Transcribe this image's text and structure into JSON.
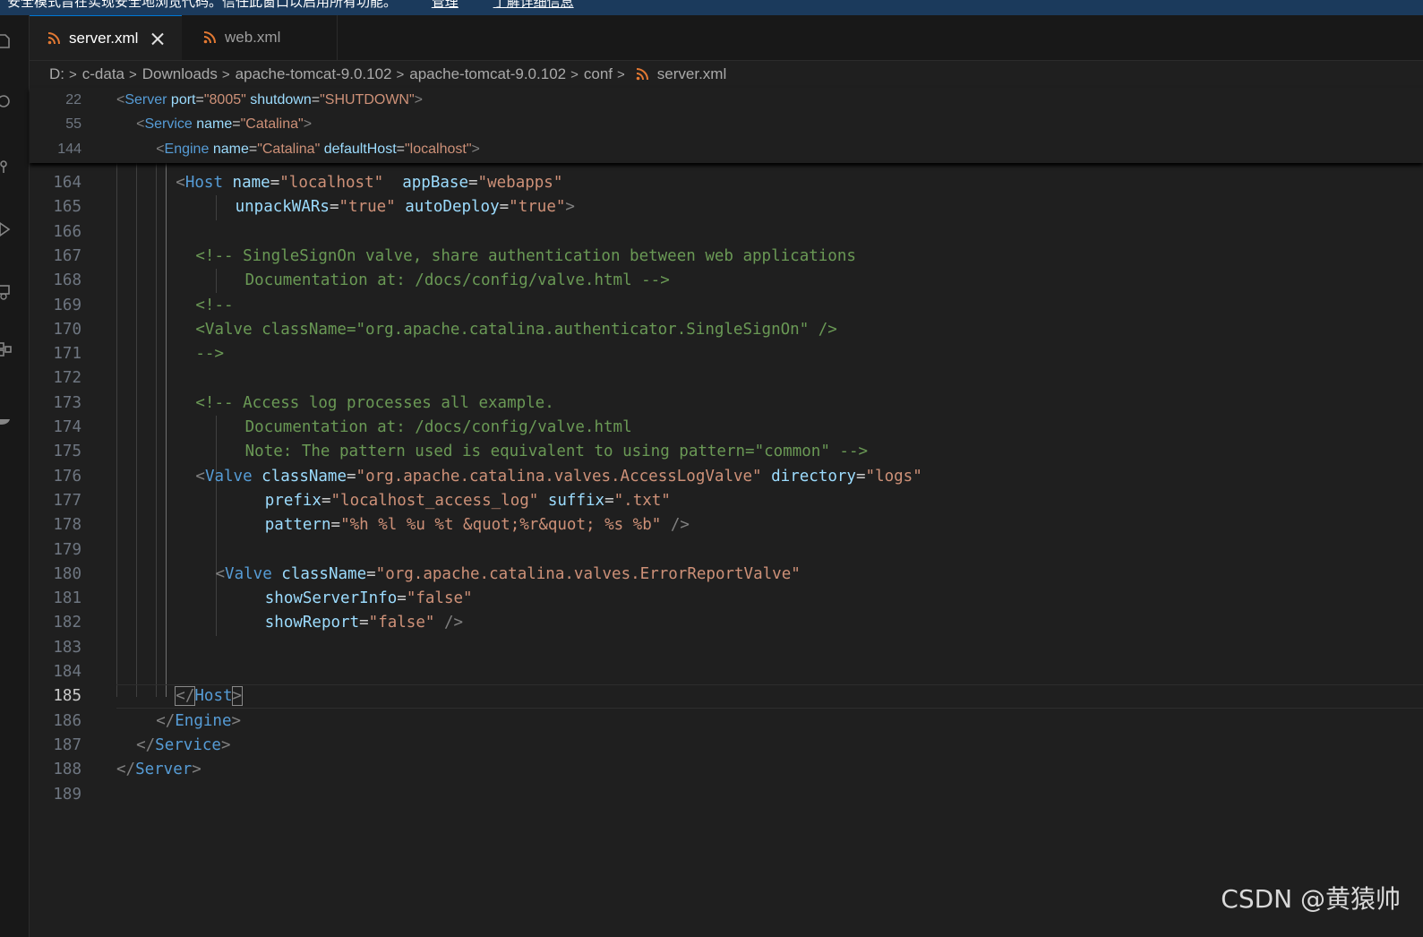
{
  "banner": {
    "text": "安全模式旨在实现安全地浏览代码。信任此窗口以启用所有功能。",
    "link_manage": "管理",
    "link_learn": "了解详细信息"
  },
  "tabs": [
    {
      "label": "server.xml",
      "icon": "rss-file-icon",
      "active": true
    },
    {
      "label": "web.xml",
      "icon": "rss-file-icon",
      "active": false
    }
  ],
  "breadcrumb": [
    "D:",
    "c-data",
    "Downloads",
    "apache-tomcat-9.0.102",
    "apache-tomcat-9.0.102",
    "conf",
    "server.xml"
  ],
  "sticky_lines": [
    {
      "num": "22",
      "tokens": [
        [
          "p",
          "<"
        ],
        [
          "t",
          "Server"
        ],
        [
          "e",
          " "
        ],
        [
          "a",
          "port"
        ],
        [
          "e",
          "="
        ],
        [
          "s",
          "\"8005\""
        ],
        [
          "e",
          " "
        ],
        [
          "a",
          "shutdown"
        ],
        [
          "e",
          "="
        ],
        [
          "s",
          "\"SHUTDOWN\""
        ],
        [
          "p",
          ">"
        ]
      ],
      "indent": 0
    },
    {
      "num": "55",
      "tokens": [
        [
          "p",
          "<"
        ],
        [
          "t",
          "Service"
        ],
        [
          "e",
          " "
        ],
        [
          "a",
          "name"
        ],
        [
          "e",
          "="
        ],
        [
          "s",
          "\"Catalina\""
        ],
        [
          "p",
          ">"
        ]
      ],
      "indent": 2
    },
    {
      "num": "144",
      "tokens": [
        [
          "p",
          "<"
        ],
        [
          "t",
          "Engine"
        ],
        [
          "e",
          " "
        ],
        [
          "a",
          "name"
        ],
        [
          "e",
          "="
        ],
        [
          "s",
          "\"Catalina\""
        ],
        [
          "e",
          " "
        ],
        [
          "a",
          "defaultHost"
        ],
        [
          "e",
          "="
        ],
        [
          "s",
          "\"localhost\""
        ],
        [
          "p",
          ">"
        ]
      ],
      "indent": 4
    }
  ],
  "lines": [
    {
      "num": "164",
      "indent": 6,
      "tokens": [
        [
          "p",
          "<"
        ],
        [
          "t",
          "Host"
        ],
        [
          "e",
          " "
        ],
        [
          "a",
          "name"
        ],
        [
          "e",
          "="
        ],
        [
          "s",
          "\"localhost\""
        ],
        [
          "e",
          "  "
        ],
        [
          "a",
          "appBase"
        ],
        [
          "e",
          "="
        ],
        [
          "s",
          "\"webapps\""
        ]
      ]
    },
    {
      "num": "165",
      "indent": 12,
      "tokens": [
        [
          "a",
          "unpackWARs"
        ],
        [
          "e",
          "="
        ],
        [
          "s",
          "\"true\""
        ],
        [
          "e",
          " "
        ],
        [
          "a",
          "autoDeploy"
        ],
        [
          "e",
          "="
        ],
        [
          "s",
          "\"true\""
        ],
        [
          "p",
          ">"
        ]
      ]
    },
    {
      "num": "166",
      "indent": 0,
      "tokens": []
    },
    {
      "num": "167",
      "indent": 8,
      "tokens": [
        [
          "c",
          "<!-- SingleSignOn valve, share authentication between web applications"
        ]
      ]
    },
    {
      "num": "168",
      "indent": 13,
      "tokens": [
        [
          "c",
          "Documentation at: /docs/config/valve.html -->"
        ]
      ]
    },
    {
      "num": "169",
      "indent": 8,
      "tokens": [
        [
          "c",
          "<!--"
        ]
      ]
    },
    {
      "num": "170",
      "indent": 8,
      "tokens": [
        [
          "c",
          "<Valve className=\"org.apache.catalina.authenticator.SingleSignOn\" />"
        ]
      ]
    },
    {
      "num": "171",
      "indent": 8,
      "tokens": [
        [
          "c",
          "-->"
        ]
      ]
    },
    {
      "num": "172",
      "indent": 0,
      "tokens": []
    },
    {
      "num": "173",
      "indent": 8,
      "tokens": [
        [
          "c",
          "<!-- Access log processes all example."
        ]
      ]
    },
    {
      "num": "174",
      "indent": 13,
      "tokens": [
        [
          "c",
          "Documentation at: /docs/config/valve.html"
        ]
      ]
    },
    {
      "num": "175",
      "indent": 13,
      "tokens": [
        [
          "c",
          "Note: The pattern used is equivalent to using pattern=\"common\" -->"
        ]
      ]
    },
    {
      "num": "176",
      "indent": 8,
      "tokens": [
        [
          "p",
          "<"
        ],
        [
          "t",
          "Valve"
        ],
        [
          "e",
          " "
        ],
        [
          "a",
          "className"
        ],
        [
          "e",
          "="
        ],
        [
          "s",
          "\"org.apache.catalina.valves.AccessLogValve\""
        ],
        [
          "e",
          " "
        ],
        [
          "a",
          "directory"
        ],
        [
          "e",
          "="
        ],
        [
          "s",
          "\"logs\""
        ]
      ]
    },
    {
      "num": "177",
      "indent": 15,
      "tokens": [
        [
          "a",
          "prefix"
        ],
        [
          "e",
          "="
        ],
        [
          "s",
          "\"localhost_access_log\""
        ],
        [
          "e",
          " "
        ],
        [
          "a",
          "suffix"
        ],
        [
          "e",
          "="
        ],
        [
          "s",
          "\".txt\""
        ]
      ]
    },
    {
      "num": "178",
      "indent": 15,
      "tokens": [
        [
          "a",
          "pattern"
        ],
        [
          "e",
          "="
        ],
        [
          "s",
          "\"%h %l %u %t &quot;%r&quot; %s %b\""
        ],
        [
          "e",
          " "
        ],
        [
          "p",
          "/>"
        ]
      ]
    },
    {
      "num": "179",
      "indent": 0,
      "tokens": []
    },
    {
      "num": "180",
      "indent": 10,
      "tokens": [
        [
          "p",
          "<"
        ],
        [
          "t",
          "Valve"
        ],
        [
          "e",
          " "
        ],
        [
          "a",
          "className"
        ],
        [
          "e",
          "="
        ],
        [
          "s",
          "\"org.apache.catalina.valves.ErrorReportValve\""
        ]
      ]
    },
    {
      "num": "181",
      "indent": 15,
      "tokens": [
        [
          "a",
          "showServerInfo"
        ],
        [
          "e",
          "="
        ],
        [
          "s",
          "\"false\""
        ]
      ]
    },
    {
      "num": "182",
      "indent": 15,
      "tokens": [
        [
          "a",
          "showReport"
        ],
        [
          "e",
          "="
        ],
        [
          "s",
          "\"false\""
        ],
        [
          "e",
          " "
        ],
        [
          "p",
          "/>"
        ]
      ]
    },
    {
      "num": "183",
      "indent": 0,
      "tokens": []
    },
    {
      "num": "184",
      "indent": 0,
      "tokens": []
    },
    {
      "num": "185",
      "indent": 6,
      "current": true,
      "tokens": [
        [
          "p",
          "</"
        ],
        [
          "t",
          "Host"
        ],
        [
          "p",
          ">"
        ]
      ]
    },
    {
      "num": "186",
      "indent": 4,
      "tokens": [
        [
          "p",
          "</"
        ],
        [
          "t",
          "Engine"
        ],
        [
          "p",
          ">"
        ]
      ]
    },
    {
      "num": "187",
      "indent": 2,
      "tokens": [
        [
          "p",
          "</"
        ],
        [
          "t",
          "Service"
        ],
        [
          "p",
          ">"
        ]
      ]
    },
    {
      "num": "188",
      "indent": 0,
      "tokens": [
        [
          "p",
          "</"
        ],
        [
          "t",
          "Server"
        ],
        [
          "p",
          ">"
        ]
      ]
    },
    {
      "num": "189",
      "indent": 0,
      "tokens": []
    }
  ],
  "activity_icons": [
    "explorer-icon",
    "search-icon",
    "source-control-icon",
    "run-debug-icon",
    "remote-explorer-icon",
    "extensions-icon",
    "docker-icon"
  ],
  "watermark": "CSDN @黄猿帅",
  "colors": {
    "tag": "#569cd6",
    "attribute": "#9cdcfe",
    "string": "#ce9178",
    "comment": "#6a9955",
    "punctuation": "#808080",
    "banner_bg": "#1b3a5c"
  }
}
